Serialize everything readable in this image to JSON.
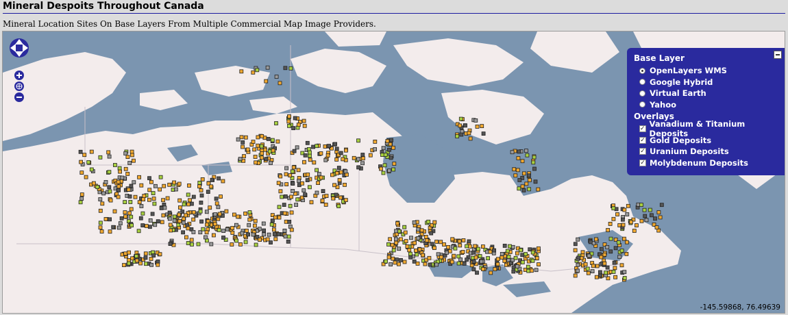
{
  "header": {
    "title": "Mineral Despoits Throughout Canada",
    "subtitle": "Mineral Location Sites On Base Layers From Multiple Commercial Map Image Providers."
  },
  "layer_switcher": {
    "base_heading": "Base Layer",
    "base_layers": [
      {
        "label": "OpenLayers WMS",
        "selected": true
      },
      {
        "label": "Google Hybrid",
        "selected": false
      },
      {
        "label": "Virtual Earth",
        "selected": false
      },
      {
        "label": "Yahoo",
        "selected": false
      }
    ],
    "overlays_heading": "Overlays",
    "overlays": [
      {
        "label": "Vanadium & Titanium Deposits",
        "checked": true
      },
      {
        "label": "Gold Deposits",
        "checked": true
      },
      {
        "label": "Uranium Deposits",
        "checked": true
      },
      {
        "label": "Molybdenum Deposits",
        "checked": true
      }
    ]
  },
  "coords": "-145.59868, 76.49639",
  "colors": {
    "water": "#7b95b0",
    "land": "#f3ecec",
    "panel": "#2a2a9e",
    "gold_marker": "#f0a830",
    "molybdenum_marker": "#9a9a9a",
    "uranium_marker": "#a8d040",
    "vanadium_marker": "#555555",
    "title_rule": "#1a1aa0"
  }
}
